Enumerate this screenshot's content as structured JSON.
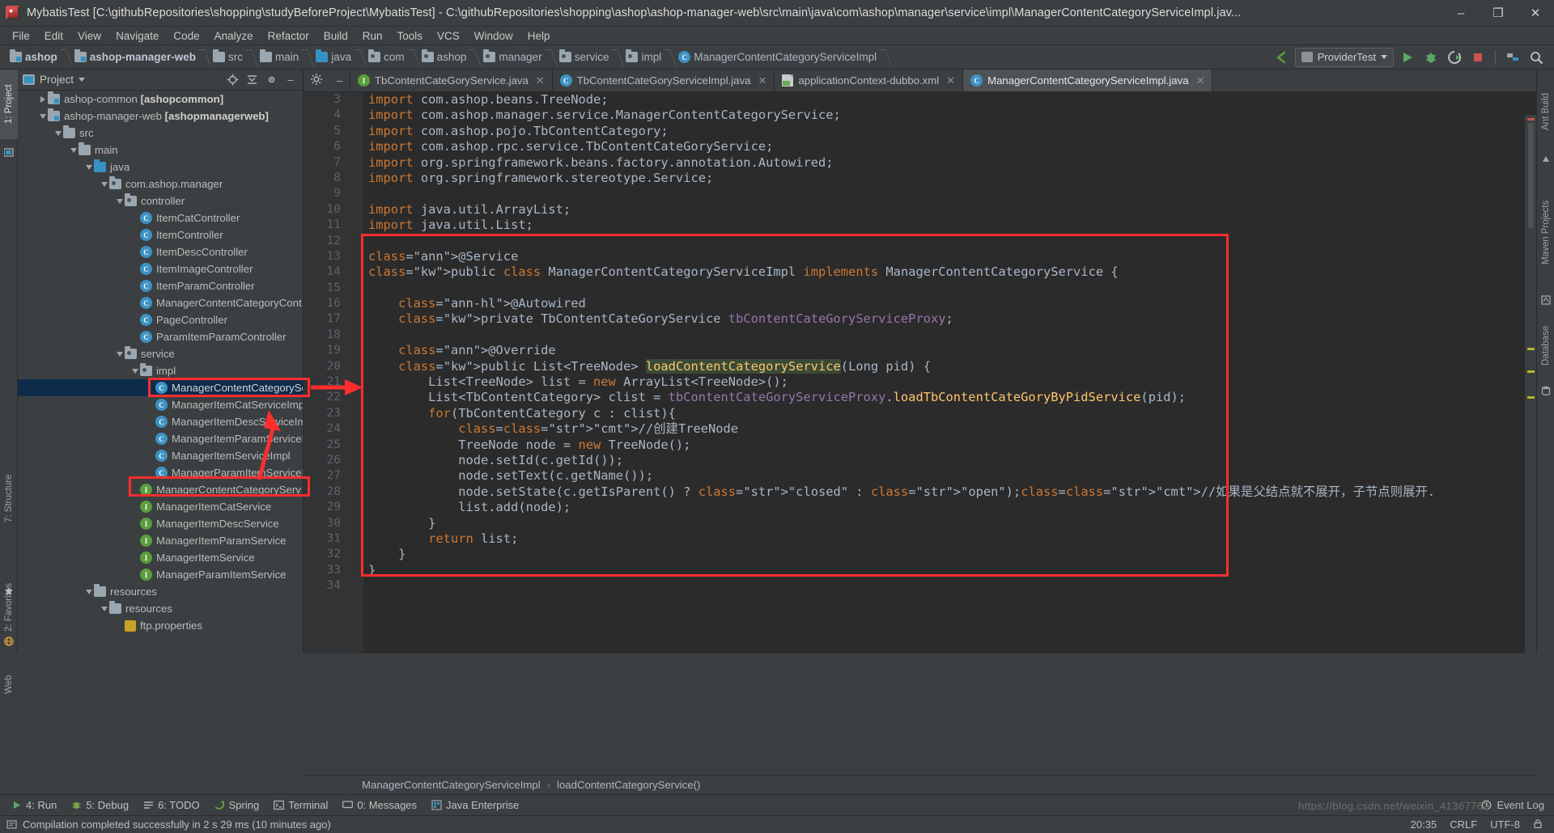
{
  "window": {
    "title": "MybatisTest [C:\\githubRepositories\\shopping\\studyBeforeProject\\MybatisTest] - C:\\githubRepositories\\shopping\\ashop\\ashop-manager-web\\src\\main\\java\\com\\ashop\\manager\\service\\impl\\ManagerContentCategoryServiceImpl.jav...",
    "icon": "intellij-idea-icon",
    "minimize": "–",
    "maximize": "❐",
    "close": "✕"
  },
  "menubar": {
    "items": [
      "File",
      "Edit",
      "View",
      "Navigate",
      "Code",
      "Analyze",
      "Refactor",
      "Build",
      "Run",
      "Tools",
      "VCS",
      "Window",
      "Help"
    ]
  },
  "navbar": {
    "crumbs": [
      {
        "label": "ashop",
        "icon": "module-folder-icon",
        "bold": true
      },
      {
        "label": "ashop-manager-web",
        "icon": "module-folder-icon",
        "bold": true
      },
      {
        "label": "src",
        "icon": "folder-icon",
        "bold": false
      },
      {
        "label": "main",
        "icon": "folder-icon",
        "bold": false
      },
      {
        "label": "java",
        "icon": "source-folder-icon",
        "bold": false
      },
      {
        "label": "com",
        "icon": "package-icon",
        "bold": false
      },
      {
        "label": "ashop",
        "icon": "package-icon",
        "bold": false
      },
      {
        "label": "manager",
        "icon": "package-icon",
        "bold": false
      },
      {
        "label": "service",
        "icon": "package-icon",
        "bold": false
      },
      {
        "label": "impl",
        "icon": "package-icon",
        "bold": false
      },
      {
        "label": "ManagerContentCategoryServiceImpl",
        "icon": "class-icon",
        "bold": false
      }
    ],
    "run_config": "ProviderTest",
    "icons": [
      "back-arrow-icon",
      "run-icon",
      "debug-icon",
      "run-coverage-icon",
      "stop-icon",
      "project-structure-icon",
      "search-everywhere-icon"
    ]
  },
  "project_panel": {
    "title": "Project",
    "header_icons": [
      "locate-icon",
      "collapse-all-icon",
      "settings-icon",
      "hide-icon"
    ],
    "tree": [
      {
        "indent": 1,
        "arrow": "right",
        "icon": "module-folder-icon",
        "label": "ashop-common ",
        "bold": "[ashopcommon]"
      },
      {
        "indent": 1,
        "arrow": "down",
        "icon": "module-folder-icon",
        "label": "ashop-manager-web ",
        "bold": "[ashopmanagerweb]"
      },
      {
        "indent": 2,
        "arrow": "down",
        "icon": "folder-icon",
        "label": "src",
        "bold": ""
      },
      {
        "indent": 3,
        "arrow": "down",
        "icon": "folder-icon",
        "label": "main",
        "bold": ""
      },
      {
        "indent": 4,
        "arrow": "down",
        "icon": "source-folder-icon",
        "label": "java",
        "bold": ""
      },
      {
        "indent": 5,
        "arrow": "down",
        "icon": "package-icon",
        "label": "com.ashop.manager",
        "bold": ""
      },
      {
        "indent": 6,
        "arrow": "down",
        "icon": "package-icon",
        "label": "controller",
        "bold": ""
      },
      {
        "indent": 7,
        "arrow": "none",
        "icon": "class-icon",
        "label": "ItemCatController",
        "bold": ""
      },
      {
        "indent": 7,
        "arrow": "none",
        "icon": "class-icon",
        "label": "ItemController",
        "bold": ""
      },
      {
        "indent": 7,
        "arrow": "none",
        "icon": "class-icon",
        "label": "ItemDescController",
        "bold": ""
      },
      {
        "indent": 7,
        "arrow": "none",
        "icon": "class-icon",
        "label": "ItemImageController",
        "bold": ""
      },
      {
        "indent": 7,
        "arrow": "none",
        "icon": "class-icon",
        "label": "ItemParamController",
        "bold": ""
      },
      {
        "indent": 7,
        "arrow": "none",
        "icon": "class-icon",
        "label": "ManagerContentCategoryCont",
        "bold": ""
      },
      {
        "indent": 7,
        "arrow": "none",
        "icon": "class-icon",
        "label": "PageController",
        "bold": ""
      },
      {
        "indent": 7,
        "arrow": "none",
        "icon": "class-icon",
        "label": "ParamItemParamController",
        "bold": ""
      },
      {
        "indent": 6,
        "arrow": "down",
        "icon": "package-icon",
        "label": "service",
        "bold": ""
      },
      {
        "indent": 7,
        "arrow": "down",
        "icon": "package-icon",
        "label": "impl",
        "bold": ""
      },
      {
        "indent": 8,
        "arrow": "none",
        "icon": "class-icon",
        "label": "ManagerContentCategorySe",
        "bold": "",
        "selected": true
      },
      {
        "indent": 8,
        "arrow": "none",
        "icon": "class-icon",
        "label": "ManagerItemCatServiceImpl",
        "bold": ""
      },
      {
        "indent": 8,
        "arrow": "none",
        "icon": "class-icon",
        "label": "ManagerItemDescServiceIm",
        "bold": ""
      },
      {
        "indent": 8,
        "arrow": "none",
        "icon": "class-icon",
        "label": "ManagerItemParamServiceI",
        "bold": ""
      },
      {
        "indent": 8,
        "arrow": "none",
        "icon": "class-icon",
        "label": "ManagerItemServiceImpl",
        "bold": ""
      },
      {
        "indent": 8,
        "arrow": "none",
        "icon": "class-icon",
        "label": "ManagerParamItemServiceI",
        "bold": ""
      },
      {
        "indent": 7,
        "arrow": "none",
        "icon": "interface-icon",
        "label": "ManagerContentCategoryServ",
        "bold": ""
      },
      {
        "indent": 7,
        "arrow": "none",
        "icon": "interface-icon",
        "label": "ManagerItemCatService",
        "bold": ""
      },
      {
        "indent": 7,
        "arrow": "none",
        "icon": "interface-icon",
        "label": "ManagerItemDescService",
        "bold": ""
      },
      {
        "indent": 7,
        "arrow": "none",
        "icon": "interface-icon",
        "label": "ManagerItemParamService",
        "bold": ""
      },
      {
        "indent": 7,
        "arrow": "none",
        "icon": "interface-icon",
        "label": "ManagerItemService",
        "bold": ""
      },
      {
        "indent": 7,
        "arrow": "none",
        "icon": "interface-icon",
        "label": "ManagerParamItemService",
        "bold": ""
      },
      {
        "indent": 4,
        "arrow": "down",
        "icon": "folder-icon",
        "label": "resources",
        "bold": ""
      },
      {
        "indent": 5,
        "arrow": "down",
        "icon": "folder-icon",
        "label": "resources",
        "bold": ""
      },
      {
        "indent": 6,
        "arrow": "none",
        "icon": "properties-icon",
        "label": "ftp.properties",
        "bold": ""
      }
    ]
  },
  "editor": {
    "tabs": [
      {
        "label": "TbContentCateGoryService.java",
        "icon": "interface-icon",
        "active": false,
        "closable": true
      },
      {
        "label": "TbContentCateGoryServiceImpl.java",
        "icon": "class-icon",
        "active": false,
        "closable": true
      },
      {
        "label": "applicationContext-dubbo.xml",
        "icon": "xml-file-icon",
        "active": false,
        "closable": true
      },
      {
        "label": "ManagerContentCategoryServiceImpl.java",
        "icon": "class-icon",
        "active": true,
        "closable": true
      }
    ],
    "first_line_number": 3,
    "line_numbers": [
      3,
      4,
      5,
      6,
      7,
      8,
      9,
      10,
      11,
      12,
      13,
      14,
      15,
      16,
      17,
      18,
      19,
      20,
      21,
      22,
      23,
      24,
      25,
      26,
      27,
      28,
      29,
      30,
      31,
      32,
      33,
      34
    ],
    "caret_line": 20,
    "code_lines": [
      "import com.ashop.beans.TreeNode;",
      "import com.ashop.manager.service.ManagerContentCategoryService;",
      "import com.ashop.pojo.TbContentCategory;",
      "import com.ashop.rpc.service.TbContentCateGoryService;",
      "import org.springframework.beans.factory.annotation.Autowired;",
      "import org.springframework.stereotype.Service;",
      "",
      "import java.util.ArrayList;",
      "import java.util.List;",
      "",
      "@Service",
      "public class ManagerContentCategoryServiceImpl implements ManagerContentCategoryService {",
      "",
      "    @Autowired",
      "    private TbContentCateGoryService tbContentCateGoryServiceProxy;",
      "",
      "    @Override",
      "    public List<TreeNode> loadContentCategoryService(Long pid) {",
      "        List<TreeNode> list = new ArrayList<TreeNode>();",
      "        List<TbContentCategory> clist = tbContentCateGoryServiceProxy.loadTbContentCateGoryByPidService(pid);",
      "        for(TbContentCategory c : clist){",
      "            //创建TreeNode",
      "            TreeNode node = new TreeNode();",
      "            node.setId(c.getId());",
      "            node.setText(c.getName());",
      "            node.setState(c.getIsParent() ? \"closed\" : \"open\");//如果是父结点就不展开，子节点则展开.",
      "            list.add(node);",
      "        }",
      "        return list;",
      "    }",
      "}"
    ],
    "breadcrumb": {
      "class": "ManagerContentCategoryServiceImpl",
      "method": "loadContentCategoryService()"
    }
  },
  "left_strip": {
    "items": [
      "1: Project",
      "7: Structure",
      "2: Favorites",
      "Web"
    ]
  },
  "right_strip": {
    "items": [
      "Ant Build",
      "Maven Projects",
      "Database"
    ]
  },
  "bottombar": {
    "items": [
      {
        "label": "4: Run",
        "icon": "run-icon"
      },
      {
        "label": "5: Debug",
        "icon": "debug-icon"
      },
      {
        "label": "6: TODO",
        "icon": "todo-icon"
      },
      {
        "label": "Spring",
        "icon": "spring-icon"
      },
      {
        "label": "Terminal",
        "icon": "terminal-icon"
      },
      {
        "label": "0: Messages",
        "icon": "messages-icon"
      },
      {
        "label": "Java Enterprise",
        "icon": "java-enterprise-icon"
      }
    ],
    "event_log": "Event Log"
  },
  "statusbar": {
    "message": "Compilation completed successfully in 2 s 29 ms (10 minutes ago)",
    "caret_position": "20:35",
    "line_separator": "CRLF",
    "encoding": "UTF-8",
    "lock_icon": "lock-icon",
    "watermark": "https://blog.csdn.net/weixin_41367762"
  },
  "annotations": {
    "color": "#ff2d2d",
    "boxes": [
      "tree-selected-class-box",
      "tree-interface-box",
      "code-block-box"
    ],
    "arrows": [
      "arrow-tree-to-code",
      "arrow-impl-to-interface"
    ]
  },
  "colors": {
    "background": "#3c3f41",
    "editor_bg": "#2b2b2b",
    "accent": "#3592c4",
    "selection": "#0d2c4b",
    "annotation": "#ff2d2d",
    "keyword": "#cc7832",
    "string": "#6a8759",
    "annotation_kw": "#bbb529",
    "field": "#9876aa",
    "method": "#ffc66d"
  }
}
